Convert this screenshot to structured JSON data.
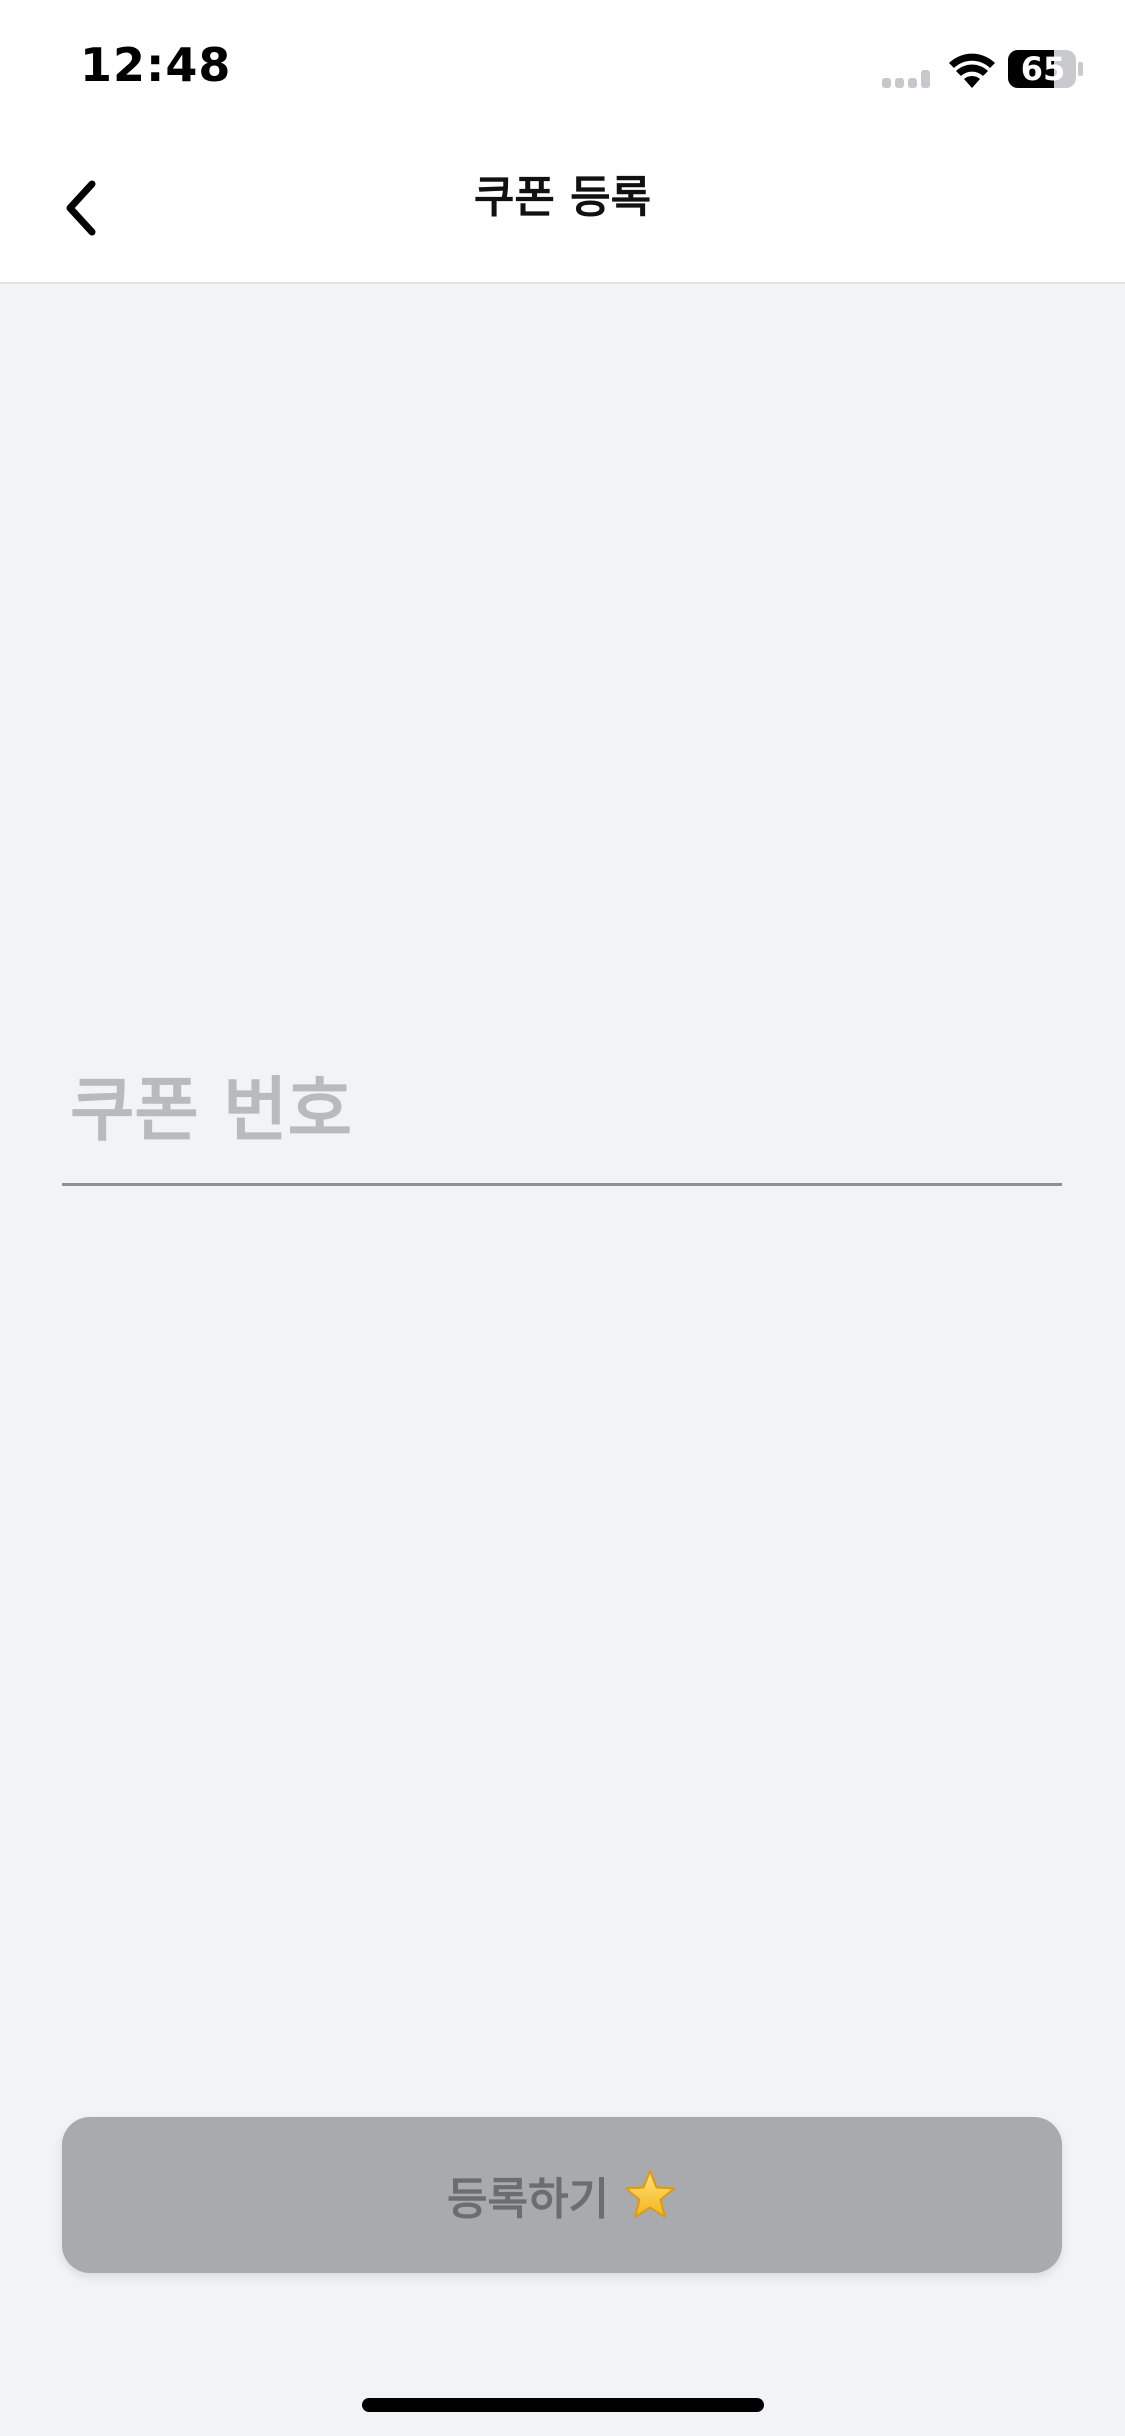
{
  "status_bar": {
    "time": "12:48",
    "battery": "65",
    "icons": [
      "signal-icon",
      "wifi-icon",
      "battery-icon"
    ]
  },
  "nav": {
    "title": "쿠폰 등록",
    "back_icon": "chevron-left-icon"
  },
  "coupon": {
    "placeholder": "쿠폰 번호",
    "value": ""
  },
  "submit": {
    "label": "등록하기",
    "icon": "star-icon"
  },
  "colors": {
    "background": "#f2f3f7",
    "button_disabled": "#a9aaad",
    "star": "#f7c42f"
  }
}
